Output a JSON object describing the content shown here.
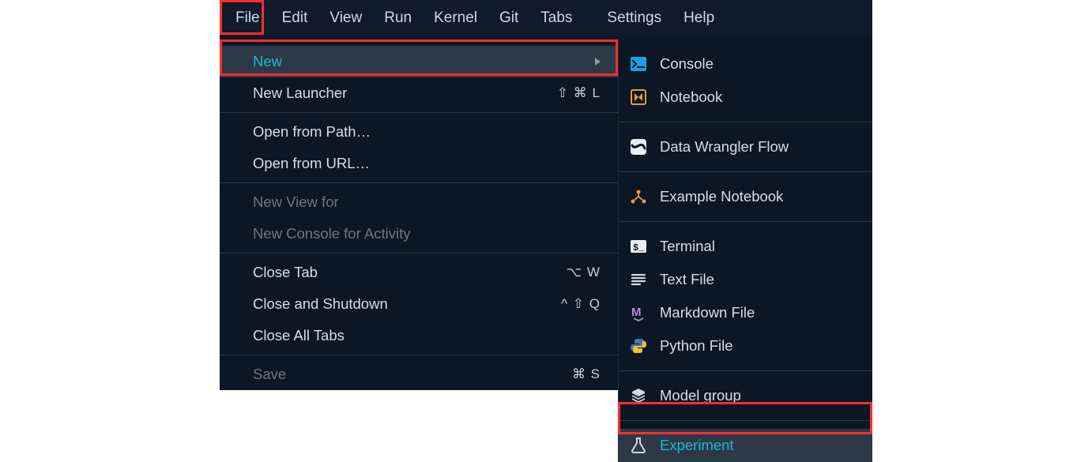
{
  "menubar": {
    "items": [
      "File",
      "Edit",
      "View",
      "Run",
      "Kernel",
      "Git",
      "Tabs",
      "Settings",
      "Help"
    ],
    "open_index": 0
  },
  "file_menu": {
    "groups": [
      [
        {
          "label": "New",
          "submenu": true,
          "hovered": true,
          "selected": true
        },
        {
          "label": "New Launcher",
          "shortcut": "⇧ ⌘ L"
        }
      ],
      [
        {
          "label": "Open from Path…"
        },
        {
          "label": "Open from URL…"
        }
      ],
      [
        {
          "label": "New View for",
          "disabled": true
        },
        {
          "label": "New Console for Activity",
          "disabled": true
        }
      ],
      [
        {
          "label": "Close Tab",
          "shortcut": "⌥ W"
        },
        {
          "label": "Close and Shutdown",
          "shortcut": "^ ⇧ Q"
        },
        {
          "label": "Close All Tabs"
        }
      ],
      [
        {
          "label": "Save",
          "shortcut": "⌘ S",
          "disabled": true
        }
      ]
    ]
  },
  "new_submenu": {
    "groups": [
      [
        {
          "label": "Console",
          "icon": "console"
        },
        {
          "label": "Notebook",
          "icon": "notebook"
        }
      ],
      [
        {
          "label": "Data Wrangler Flow",
          "icon": "datawrangler"
        }
      ],
      [
        {
          "label": "Example Notebook",
          "icon": "example"
        }
      ],
      [
        {
          "label": "Terminal",
          "icon": "terminal"
        },
        {
          "label": "Text File",
          "icon": "textfile"
        },
        {
          "label": "Markdown File",
          "icon": "markdown"
        },
        {
          "label": "Python File",
          "icon": "python"
        }
      ],
      [
        {
          "label": "Model group",
          "icon": "modelgroup"
        }
      ],
      [
        {
          "label": "Experiment",
          "icon": "experiment",
          "hovered": true,
          "active": true
        }
      ]
    ]
  },
  "highlights": {
    "file_menu_item": true,
    "new_row": true,
    "experiment_row": true
  }
}
